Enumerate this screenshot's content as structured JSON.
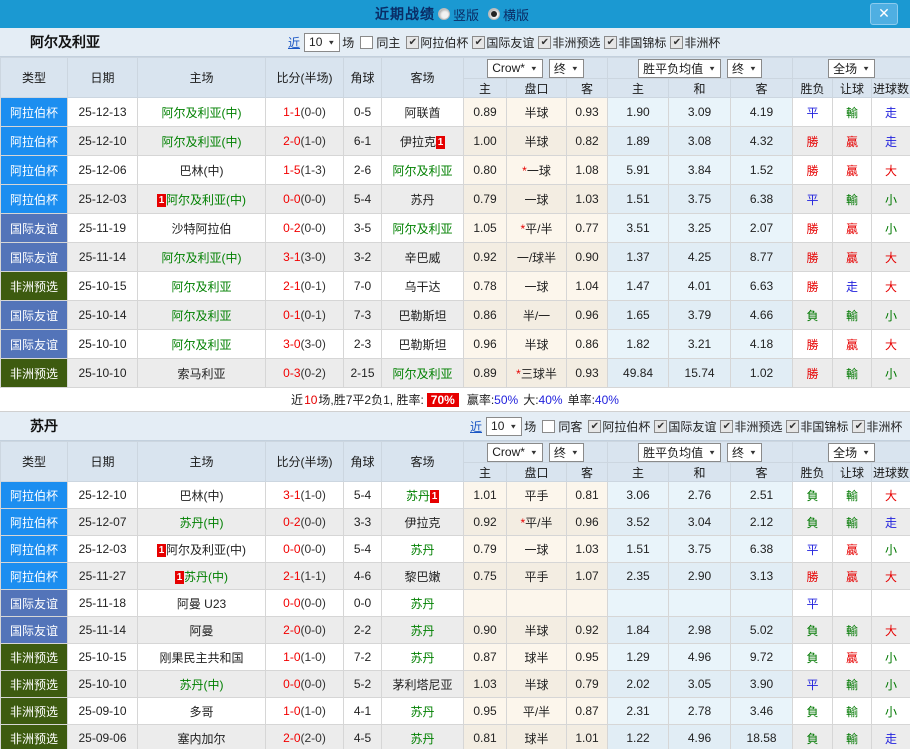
{
  "colors": {
    "accent_bar": "#1b99d2",
    "win_red": "#e60000",
    "draw_blue": "#2222dd",
    "lose_green": "#008000",
    "team_green": "#008000",
    "type_arab_cup": "#1c8ef0",
    "type_friendly": "#5374b9",
    "type_africa_qual": "#3d5b10",
    "rate_badge_bg": "#e60000"
  },
  "icons": {
    "dropdown_arrow": "▼",
    "close": "✕",
    "check": "✔",
    "star": "*"
  },
  "titlebar": {
    "title": "近期战绩",
    "radio_vertical": "竖版",
    "radio_horizontal": "横版"
  },
  "table_header": {
    "main": [
      "类型",
      "日期",
      "主场",
      "比分(半场)",
      "角球",
      "客场"
    ],
    "sub": [
      "主",
      "盘口",
      "客",
      "主",
      "和",
      "客",
      "胜负",
      "让球",
      "进球数"
    ],
    "crow_select": "Crow*",
    "crow_time_select": "终",
    "avg_select": "胜平负均值",
    "avg_time_select": "终",
    "scope_select": "全场"
  },
  "sections": [
    {
      "team": "阿尔及利亚",
      "near_label": "近",
      "near_value": "10",
      "games_label": "场",
      "same_label": "同主",
      "same_checked": false,
      "competitions": [
        "阿拉伯杯",
        "国际友谊",
        "非洲预选",
        "非国锦标",
        "非洲杯"
      ],
      "rows": [
        {
          "type": "阿拉伯杯",
          "tc": "arab",
          "date": "25-12-13",
          "hb": "",
          "home": "阿尔及利亚(中)",
          "hg": true,
          "score": "1-1",
          "half": "(0-0)",
          "corner": "0-5",
          "away": "阿联酋",
          "ag": false,
          "ab": "",
          "ch": "0.89",
          "hs": false,
          "hc": "半球",
          "ca": "0.93",
          "ah": "1.90",
          "ad": "3.09",
          "aa": "4.19",
          "r": "平",
          "rc": "blue",
          "l": "輸",
          "lc": "green",
          "g": "走",
          "gc": "blue"
        },
        {
          "type": "阿拉伯杯",
          "tc": "arab",
          "date": "25-12-10",
          "hb": "",
          "home": "阿尔及利亚(中)",
          "hg": true,
          "score": "2-0",
          "half": "(1-0)",
          "corner": "6-1",
          "away": "伊拉克",
          "ag": false,
          "ab": "1",
          "ch": "1.00",
          "hs": false,
          "hc": "半球",
          "ca": "0.82",
          "ah": "1.89",
          "ad": "3.08",
          "aa": "4.32",
          "r": "勝",
          "rc": "red",
          "l": "贏",
          "lc": "red",
          "g": "走",
          "gc": "blue"
        },
        {
          "type": "阿拉伯杯",
          "tc": "arab",
          "date": "25-12-06",
          "hb": "",
          "home": "巴林(中)",
          "hg": false,
          "score": "1-5",
          "half": "(1-3)",
          "corner": "2-6",
          "away": "阿尔及利亚",
          "ag": true,
          "ab": "",
          "ch": "0.80",
          "hs": true,
          "hc": "一球",
          "ca": "1.08",
          "ah": "5.91",
          "ad": "3.84",
          "aa": "1.52",
          "r": "勝",
          "rc": "red",
          "l": "贏",
          "lc": "red",
          "g": "大",
          "gc": "red"
        },
        {
          "type": "阿拉伯杯",
          "tc": "arab",
          "date": "25-12-03",
          "hb": "1",
          "home": "阿尔及利亚(中)",
          "hg": true,
          "score": "0-0",
          "half": "(0-0)",
          "corner": "5-4",
          "away": "苏丹",
          "ag": false,
          "ab": "",
          "ch": "0.79",
          "hs": false,
          "hc": "一球",
          "ca": "1.03",
          "ah": "1.51",
          "ad": "3.75",
          "aa": "6.38",
          "r": "平",
          "rc": "blue",
          "l": "輸",
          "lc": "green",
          "g": "小",
          "gc": "green"
        },
        {
          "type": "国际友谊",
          "tc": "friendly",
          "date": "25-11-19",
          "hb": "",
          "home": "沙特阿拉伯",
          "hg": false,
          "score": "0-2",
          "half": "(0-0)",
          "corner": "3-5",
          "away": "阿尔及利亚",
          "ag": true,
          "ab": "",
          "ch": "1.05",
          "hs": true,
          "hc": "平/半",
          "ca": "0.77",
          "ah": "3.51",
          "ad": "3.25",
          "aa": "2.07",
          "r": "勝",
          "rc": "red",
          "l": "贏",
          "lc": "red",
          "g": "小",
          "gc": "green"
        },
        {
          "type": "国际友谊",
          "tc": "friendly",
          "date": "25-11-14",
          "hb": "",
          "home": "阿尔及利亚(中)",
          "hg": true,
          "score": "3-1",
          "half": "(3-0)",
          "corner": "3-2",
          "away": "辛巴威",
          "ag": false,
          "ab": "",
          "ch": "0.92",
          "hs": false,
          "hc": "一/球半",
          "ca": "0.90",
          "ah": "1.37",
          "ad": "4.25",
          "aa": "8.77",
          "r": "勝",
          "rc": "red",
          "l": "贏",
          "lc": "red",
          "g": "大",
          "gc": "red"
        },
        {
          "type": "非洲预选",
          "tc": "afq",
          "date": "25-10-15",
          "hb": "",
          "home": "阿尔及利亚",
          "hg": true,
          "score": "2-1",
          "half": "(0-1)",
          "corner": "7-0",
          "away": "乌干达",
          "ag": false,
          "ab": "",
          "ch": "0.78",
          "hs": false,
          "hc": "一球",
          "ca": "1.04",
          "ah": "1.47",
          "ad": "4.01",
          "aa": "6.63",
          "r": "勝",
          "rc": "red",
          "l": "走",
          "lc": "blue",
          "g": "大",
          "gc": "red"
        },
        {
          "type": "国际友谊",
          "tc": "friendly",
          "date": "25-10-14",
          "hb": "",
          "home": "阿尔及利亚",
          "hg": true,
          "score": "0-1",
          "half": "(0-1)",
          "corner": "7-3",
          "away": "巴勒斯坦",
          "ag": false,
          "ab": "",
          "ch": "0.86",
          "hs": false,
          "hc": "半/一",
          "ca": "0.96",
          "ah": "1.65",
          "ad": "3.79",
          "aa": "4.66",
          "r": "負",
          "rc": "green",
          "l": "輸",
          "lc": "green",
          "g": "小",
          "gc": "green"
        },
        {
          "type": "国际友谊",
          "tc": "friendly",
          "date": "25-10-10",
          "hb": "",
          "home": "阿尔及利亚",
          "hg": true,
          "score": "3-0",
          "half": "(3-0)",
          "corner": "2-3",
          "away": "巴勒斯坦",
          "ag": false,
          "ab": "",
          "ch": "0.96",
          "hs": false,
          "hc": "半球",
          "ca": "0.86",
          "ah": "1.82",
          "ad": "3.21",
          "aa": "4.18",
          "r": "勝",
          "rc": "red",
          "l": "贏",
          "lc": "red",
          "g": "大",
          "gc": "red"
        },
        {
          "type": "非洲预选",
          "tc": "afq",
          "date": "25-10-10",
          "hb": "",
          "home": "索马利亚",
          "hg": false,
          "score": "0-3",
          "half": "(0-2)",
          "corner": "2-15",
          "away": "阿尔及利亚",
          "ag": true,
          "ab": "",
          "ch": "0.89",
          "hs": true,
          "hc": "三球半",
          "ca": "0.93",
          "ah": "49.84",
          "ad": "15.74",
          "aa": "1.02",
          "r": "勝",
          "rc": "red",
          "l": "輸",
          "lc": "green",
          "g": "小",
          "gc": "green"
        }
      ],
      "summary": {
        "lead": "近",
        "count": "10",
        "mid": "场,胜7平2负1, 胜率:",
        "win_rate": "70%",
        "stats": [
          {
            "label": "赢率:",
            "value": "50%"
          },
          {
            "label": "大:",
            "value": "40%"
          },
          {
            "label": "单率:",
            "value": "40%"
          }
        ]
      }
    },
    {
      "team": "苏丹",
      "near_label": "近",
      "near_value": "10",
      "games_label": "场",
      "same_label": "同客",
      "same_checked": false,
      "competitions": [
        "阿拉伯杯",
        "国际友谊",
        "非洲预选",
        "非国锦标",
        "非洲杯"
      ],
      "rows": [
        {
          "type": "阿拉伯杯",
          "tc": "arab",
          "date": "25-12-10",
          "hb": "",
          "home": "巴林(中)",
          "hg": false,
          "score": "3-1",
          "half": "(1-0)",
          "corner": "5-4",
          "away": "苏丹",
          "ag": true,
          "ab": "1",
          "ch": "1.01",
          "hs": false,
          "hc": "平手",
          "ca": "0.81",
          "ah": "3.06",
          "ad": "2.76",
          "aa": "2.51",
          "r": "負",
          "rc": "green",
          "l": "輸",
          "lc": "green",
          "g": "大",
          "gc": "red"
        },
        {
          "type": "阿拉伯杯",
          "tc": "arab",
          "date": "25-12-07",
          "hb": "",
          "home": "苏丹(中)",
          "hg": true,
          "score": "0-2",
          "half": "(0-0)",
          "corner": "3-3",
          "away": "伊拉克",
          "ag": false,
          "ab": "",
          "ch": "0.92",
          "hs": true,
          "hc": "平/半",
          "ca": "0.96",
          "ah": "3.52",
          "ad": "3.04",
          "aa": "2.12",
          "r": "負",
          "rc": "green",
          "l": "輸",
          "lc": "green",
          "g": "走",
          "gc": "blue"
        },
        {
          "type": "阿拉伯杯",
          "tc": "arab",
          "date": "25-12-03",
          "hb": "1",
          "home": "阿尔及利亚(中)",
          "hg": false,
          "score": "0-0",
          "half": "(0-0)",
          "corner": "5-4",
          "away": "苏丹",
          "ag": true,
          "ab": "",
          "ch": "0.79",
          "hs": false,
          "hc": "一球",
          "ca": "1.03",
          "ah": "1.51",
          "ad": "3.75",
          "aa": "6.38",
          "r": "平",
          "rc": "blue",
          "l": "贏",
          "lc": "red",
          "g": "小",
          "gc": "green"
        },
        {
          "type": "阿拉伯杯",
          "tc": "arab",
          "date": "25-11-27",
          "hb": "1",
          "home": "苏丹(中)",
          "hg": true,
          "score": "2-1",
          "half": "(1-1)",
          "corner": "4-6",
          "away": "黎巴嫩",
          "ag": false,
          "ab": "",
          "ch": "0.75",
          "hs": false,
          "hc": "平手",
          "ca": "1.07",
          "ah": "2.35",
          "ad": "2.90",
          "aa": "3.13",
          "r": "勝",
          "rc": "red",
          "l": "贏",
          "lc": "red",
          "g": "大",
          "gc": "red"
        },
        {
          "type": "国际友谊",
          "tc": "friendly",
          "date": "25-11-18",
          "hb": "",
          "home": "阿曼 U23",
          "hg": false,
          "score": "0-0",
          "half": "(0-0)",
          "corner": "0-0",
          "away": "苏丹",
          "ag": true,
          "ab": "",
          "ch": "",
          "hs": false,
          "hc": "",
          "ca": "",
          "ah": "",
          "ad": "",
          "aa": "",
          "r": "平",
          "rc": "blue",
          "l": "",
          "lc": "",
          "g": "",
          "gc": ""
        },
        {
          "type": "国际友谊",
          "tc": "friendly",
          "date": "25-11-14",
          "hb": "",
          "home": "阿曼",
          "hg": false,
          "score": "2-0",
          "half": "(0-0)",
          "corner": "2-2",
          "away": "苏丹",
          "ag": true,
          "ab": "",
          "ch": "0.90",
          "hs": false,
          "hc": "半球",
          "ca": "0.92",
          "ah": "1.84",
          "ad": "2.98",
          "aa": "5.02",
          "r": "負",
          "rc": "green",
          "l": "輸",
          "lc": "green",
          "g": "大",
          "gc": "red"
        },
        {
          "type": "非洲预选",
          "tc": "afq",
          "date": "25-10-15",
          "hb": "",
          "home": "刚果民主共和国",
          "hg": false,
          "score": "1-0",
          "half": "(1-0)",
          "corner": "7-2",
          "away": "苏丹",
          "ag": true,
          "ab": "",
          "ch": "0.87",
          "hs": false,
          "hc": "球半",
          "ca": "0.95",
          "ah": "1.29",
          "ad": "4.96",
          "aa": "9.72",
          "r": "負",
          "rc": "green",
          "l": "贏",
          "lc": "red",
          "g": "小",
          "gc": "green"
        },
        {
          "type": "非洲预选",
          "tc": "afq",
          "date": "25-10-10",
          "hb": "",
          "home": "苏丹(中)",
          "hg": true,
          "score": "0-0",
          "half": "(0-0)",
          "corner": "5-2",
          "away": "茅利塔尼亚",
          "ag": false,
          "ab": "",
          "ch": "1.03",
          "hs": false,
          "hc": "半球",
          "ca": "0.79",
          "ah": "2.02",
          "ad": "3.05",
          "aa": "3.90",
          "r": "平",
          "rc": "blue",
          "l": "輸",
          "lc": "green",
          "g": "小",
          "gc": "green"
        },
        {
          "type": "非洲预选",
          "tc": "afq",
          "date": "25-09-10",
          "hb": "",
          "home": "多哥",
          "hg": false,
          "score": "1-0",
          "half": "(1-0)",
          "corner": "4-1",
          "away": "苏丹",
          "ag": true,
          "ab": "",
          "ch": "0.95",
          "hs": false,
          "hc": "平/半",
          "ca": "0.87",
          "ah": "2.31",
          "ad": "2.78",
          "aa": "3.46",
          "r": "負",
          "rc": "green",
          "l": "輸",
          "lc": "green",
          "g": "小",
          "gc": "green"
        },
        {
          "type": "非洲预选",
          "tc": "afq",
          "date": "25-09-06",
          "hb": "",
          "home": "塞内加尔",
          "hg": false,
          "score": "2-0",
          "half": "(2-0)",
          "corner": "4-5",
          "away": "苏丹",
          "ag": true,
          "ab": "",
          "ch": "0.81",
          "hs": false,
          "hc": "球半",
          "ca": "1.01",
          "ah": "1.22",
          "ad": "4.96",
          "aa": "18.58",
          "r": "負",
          "rc": "green",
          "l": "輸",
          "lc": "green",
          "g": "走",
          "gc": "blue"
        }
      ],
      "summary": null
    }
  ]
}
